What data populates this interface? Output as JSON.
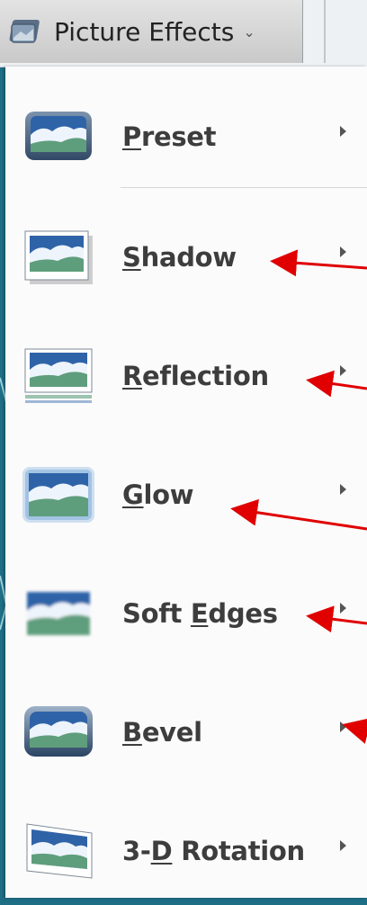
{
  "ribbon": {
    "label": "Picture Effects",
    "caret": "⌄"
  },
  "menu": {
    "items": [
      {
        "id": "preset",
        "first": "P",
        "rest": "reset",
        "pre": "",
        "icon": "preset-icon",
        "arrow": true
      },
      {
        "id": "shadow",
        "first": "S",
        "rest": "hadow",
        "pre": "",
        "icon": "shadow-icon",
        "arrow": true
      },
      {
        "id": "reflection",
        "first": "R",
        "rest": "eflection",
        "pre": "",
        "icon": "reflection-icon",
        "arrow": true
      },
      {
        "id": "glow",
        "first": "G",
        "rest": "low",
        "pre": "",
        "icon": "glow-icon",
        "arrow": true
      },
      {
        "id": "soft-edges",
        "pre": "Soft ",
        "first": "E",
        "rest": "dges",
        "icon": "soft-edges-icon",
        "arrow": true
      },
      {
        "id": "bevel",
        "first": "B",
        "rest": "evel",
        "pre": "",
        "icon": "bevel-icon",
        "arrow": true
      },
      {
        "id": "3d-rotation",
        "pre": "3-",
        "first": "D",
        "rest": " Rotation",
        "icon": "3d-rotation-icon",
        "arrow": true
      }
    ]
  },
  "colors": {
    "background": "#1e6e86",
    "menu": "#fbfbfb",
    "annotation_arrow": "#e00000",
    "icon_sky": "#2f63a8",
    "icon_land": "#5e9e7d"
  }
}
